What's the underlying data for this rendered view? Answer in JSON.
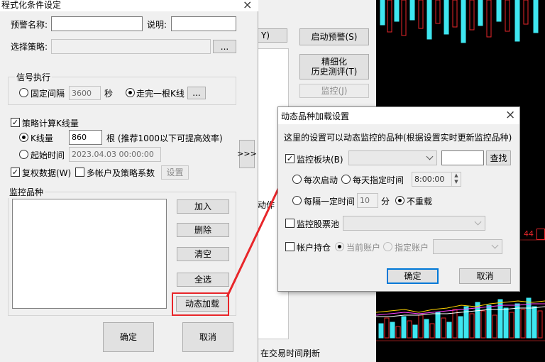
{
  "main_dialog": {
    "title": "程式化条件设定",
    "close": "×",
    "alert_name_label": "预警名称:",
    "alert_name_value": "",
    "desc_label": "说明:",
    "desc_value": "",
    "strategy_label": "选择策略:",
    "strategy_value": "",
    "browse_label": "...",
    "signal_group": "信号执行",
    "fixed_interval_label": "固定间隔",
    "fixed_interval_value": "3600",
    "seconds_unit": "秒",
    "finish_kline_label": "走完一根K线",
    "finish_kline_more": "...",
    "calc_kline_label": "策略计算K线量",
    "kline_count_label": "K线量",
    "kline_count_value": "860",
    "kline_count_hint": "根 (推荐1000以下可提高效率)",
    "start_time_label": "起始时间",
    "start_time_value": "2023.04.03 00:00:00",
    "adjust_label": "复权数据(W)",
    "multi_account_label": "多帐户及策略系数",
    "settings_label": "设置",
    "expand_label": ">>>",
    "monitor_group": "监控品种",
    "add_label": "加入",
    "delete_label": "删除",
    "clear_label": "清空",
    "select_all_label": "全选",
    "dynamic_load_label": "动态加载",
    "ok_label": "确定",
    "cancel_label": "取消"
  },
  "behind_window": {
    "y_button_partial": "Y)",
    "start_alert_label": "启动预警(S)",
    "refine_label_1": "精细化",
    "refine_label_2": "历史测评(T)",
    "monitor_label": "监控(J)",
    "partial_text": "动作",
    "bottom_text": "在交易时间刷新"
  },
  "dynamic_dialog": {
    "title": "动态品种加载设置",
    "close": "×",
    "description": "这里的设置可以动态监控的品种(根据设置实时更新监控品种)",
    "monitor_sector_label": "监控板块(B)",
    "monitor_sector_value": "",
    "sector_search_value": "",
    "search_label": "查找",
    "each_start_label": "每次启动",
    "daily_time_label": "每天指定时间",
    "daily_time_value": "8:00:00",
    "interval_label": "每隔一定时间",
    "interval_value": "10",
    "minutes_unit": "分",
    "no_repeat_label": "不重载",
    "stock_pool_label": "监控股票池",
    "account_holding_label": "帐户持仓",
    "current_account_label": "当前账户",
    "specified_account_label": "指定账户",
    "ok_label": "确定",
    "cancel_label": "取消"
  },
  "chart_panel": {
    "label_44": "44"
  },
  "colors": {
    "highlight_red": "#e8262a",
    "accent_blue": "#0078d7",
    "stock_bg": "#000000",
    "candle_cyan": "#3ee6f0",
    "candle_red": "#e8262a"
  }
}
